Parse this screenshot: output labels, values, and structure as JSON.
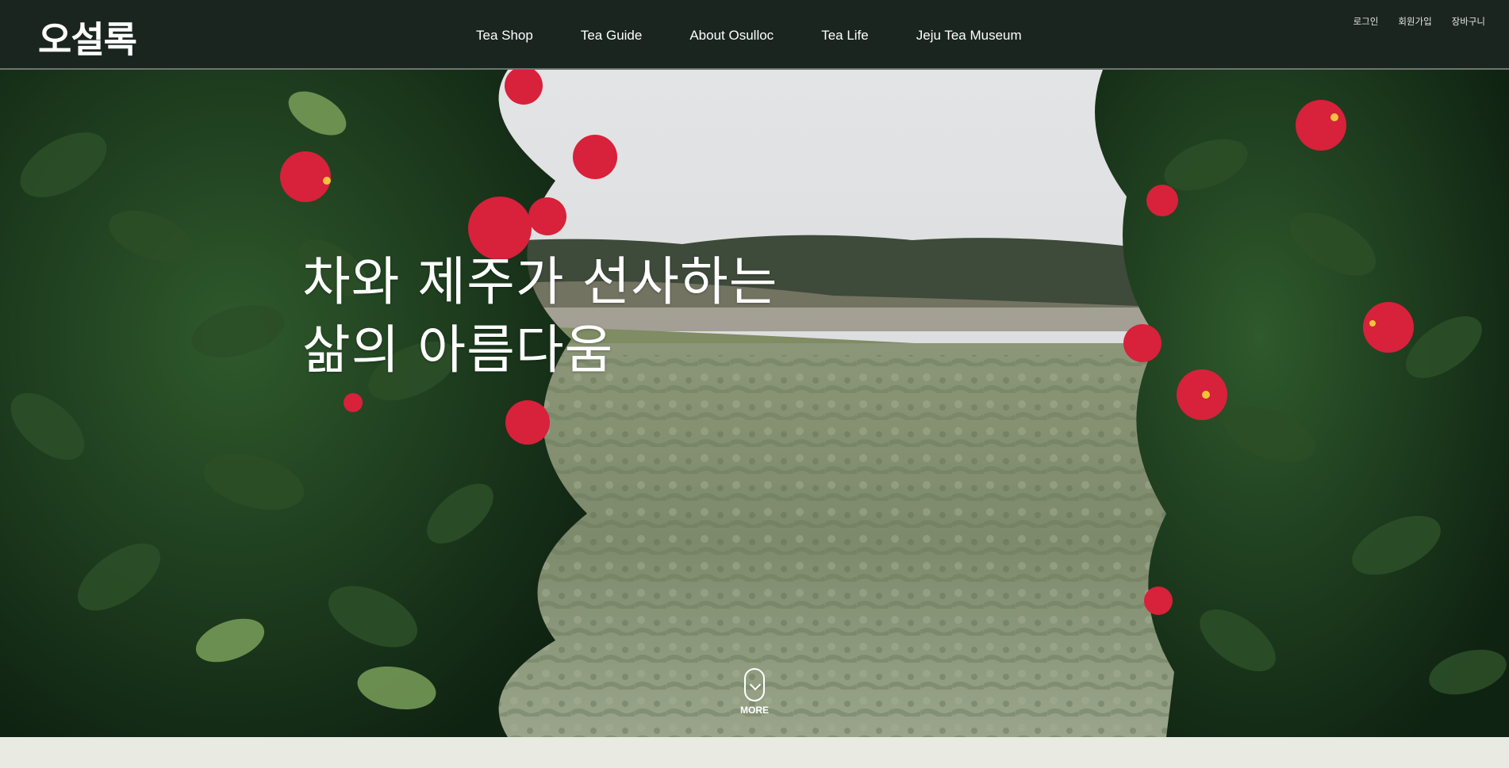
{
  "brand": {
    "logo_text": "오설록"
  },
  "nav": {
    "items": [
      "Tea Shop",
      "Tea Guide",
      "About Osulloc",
      "Tea Life",
      "Jeju Tea Museum"
    ]
  },
  "util": {
    "login": "로그인",
    "signup": "회원가입",
    "cart": "장바구니"
  },
  "hero": {
    "line1": "차와 제주가 선사하는",
    "line2": "삶의 아름다움",
    "more_label": "MORE"
  },
  "colors": {
    "header_bg": "#1a2520",
    "footer_strip": "#e9eae2",
    "flower_red": "#d8213a"
  }
}
